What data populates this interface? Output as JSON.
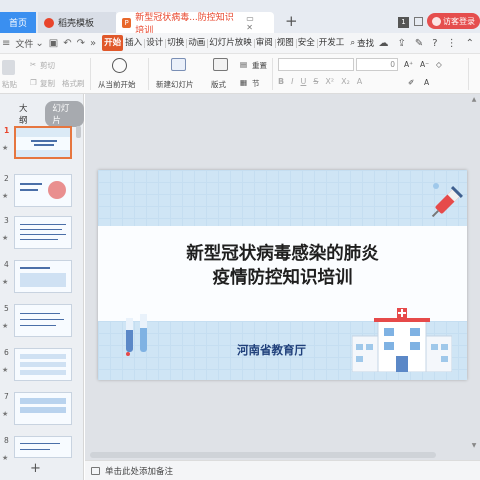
{
  "titlebar": {
    "home_tab": "首页",
    "docer_tab": "稻壳模板",
    "active_tab": "新型冠状病毒...防控知识培训",
    "window_count": "1",
    "visitor_login": "访客登录"
  },
  "menu": {
    "file": "文件",
    "tabs": [
      "开始",
      "插入",
      "设计",
      "切换",
      "动画",
      "幻灯片放映",
      "审阅",
      "视图",
      "安全",
      "开发工"
    ],
    "search": "查找"
  },
  "ribbon": {
    "paste": "粘贴",
    "cut": "剪切",
    "copy": "复制",
    "format_painter": "格式刷",
    "play_from_current": "从当前开始",
    "new_slide": "新建幻灯片",
    "layout": "版式",
    "reset": "重置",
    "section": "节",
    "font_size_value": "0"
  },
  "left_pane": {
    "outline_tab": "大纲",
    "slides_tab": "幻灯片",
    "slide_numbers": [
      "1",
      "2",
      "3",
      "4",
      "5",
      "6",
      "7",
      "8"
    ],
    "add_symbol": "+"
  },
  "slide": {
    "title_line1": "新型冠状病毒感染的肺炎",
    "title_line2": "疫情防控知识培训",
    "subtitle": "河南省教育厅"
  },
  "notes": {
    "placeholder": "单击此处添加备注"
  }
}
